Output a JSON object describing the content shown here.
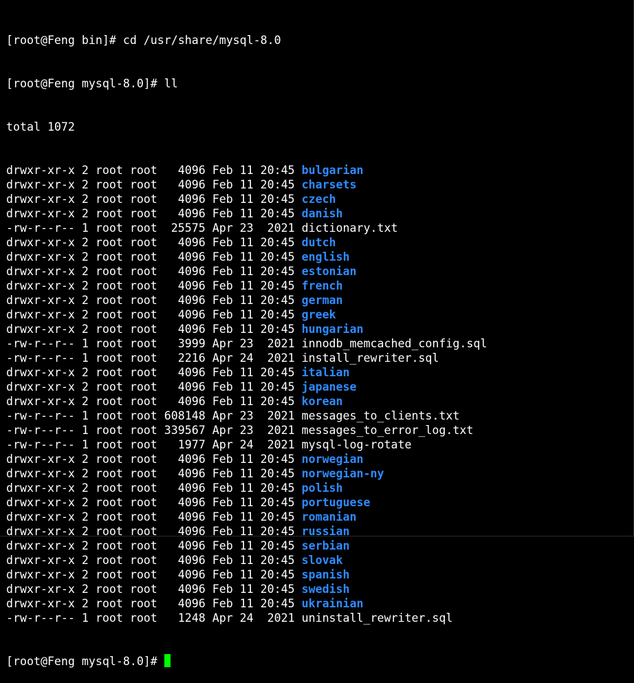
{
  "terminal": {
    "commands": [
      "[root@Feng bin]# cd /usr/share/mysql-8.0",
      "[root@Feng mysql-8.0]# ll"
    ],
    "total_line": "total 1072",
    "listing": [
      {
        "meta": "drwxr-xr-x 2 root root   4096 Feb 11 20:45 ",
        "name": "bulgarian",
        "type": "dir"
      },
      {
        "meta": "drwxr-xr-x 2 root root   4096 Feb 11 20:45 ",
        "name": "charsets",
        "type": "dir"
      },
      {
        "meta": "drwxr-xr-x 2 root root   4096 Feb 11 20:45 ",
        "name": "czech",
        "type": "dir"
      },
      {
        "meta": "drwxr-xr-x 2 root root   4096 Feb 11 20:45 ",
        "name": "danish",
        "type": "dir"
      },
      {
        "meta": "-rw-r--r-- 1 root root  25575 Apr 23  2021 ",
        "name": "dictionary.txt",
        "type": "file"
      },
      {
        "meta": "drwxr-xr-x 2 root root   4096 Feb 11 20:45 ",
        "name": "dutch",
        "type": "dir"
      },
      {
        "meta": "drwxr-xr-x 2 root root   4096 Feb 11 20:45 ",
        "name": "english",
        "type": "dir"
      },
      {
        "meta": "drwxr-xr-x 2 root root   4096 Feb 11 20:45 ",
        "name": "estonian",
        "type": "dir"
      },
      {
        "meta": "drwxr-xr-x 2 root root   4096 Feb 11 20:45 ",
        "name": "french",
        "type": "dir"
      },
      {
        "meta": "drwxr-xr-x 2 root root   4096 Feb 11 20:45 ",
        "name": "german",
        "type": "dir"
      },
      {
        "meta": "drwxr-xr-x 2 root root   4096 Feb 11 20:45 ",
        "name": "greek",
        "type": "dir"
      },
      {
        "meta": "drwxr-xr-x 2 root root   4096 Feb 11 20:45 ",
        "name": "hungarian",
        "type": "dir"
      },
      {
        "meta": "-rw-r--r-- 1 root root   3999 Apr 23  2021 ",
        "name": "innodb_memcached_config.sql",
        "type": "file"
      },
      {
        "meta": "-rw-r--r-- 1 root root   2216 Apr 24  2021 ",
        "name": "install_rewriter.sql",
        "type": "file"
      },
      {
        "meta": "drwxr-xr-x 2 root root   4096 Feb 11 20:45 ",
        "name": "italian",
        "type": "dir"
      },
      {
        "meta": "drwxr-xr-x 2 root root   4096 Feb 11 20:45 ",
        "name": "japanese",
        "type": "dir"
      },
      {
        "meta": "drwxr-xr-x 2 root root   4096 Feb 11 20:45 ",
        "name": "korean",
        "type": "dir"
      },
      {
        "meta": "-rw-r--r-- 1 root root 608148 Apr 23  2021 ",
        "name": "messages_to_clients.txt",
        "type": "file"
      },
      {
        "meta": "-rw-r--r-- 1 root root 339567 Apr 23  2021 ",
        "name": "messages_to_error_log.txt",
        "type": "file"
      },
      {
        "meta": "-rw-r--r-- 1 root root   1977 Apr 24  2021 ",
        "name": "mysql-log-rotate",
        "type": "file"
      },
      {
        "meta": "drwxr-xr-x 2 root root   4096 Feb 11 20:45 ",
        "name": "norwegian",
        "type": "dir"
      },
      {
        "meta": "drwxr-xr-x 2 root root   4096 Feb 11 20:45 ",
        "name": "norwegian-ny",
        "type": "dir"
      },
      {
        "meta": "drwxr-xr-x 2 root root   4096 Feb 11 20:45 ",
        "name": "polish",
        "type": "dir"
      },
      {
        "meta": "drwxr-xr-x 2 root root   4096 Feb 11 20:45 ",
        "name": "portuguese",
        "type": "dir"
      },
      {
        "meta": "drwxr-xr-x 2 root root   4096 Feb 11 20:45 ",
        "name": "romanian",
        "type": "dir"
      },
      {
        "meta": "drwxr-xr-x 2 root root   4096 Feb 11 20:45 ",
        "name": "russian",
        "type": "dir"
      },
      {
        "meta": "drwxr-xr-x 2 root root   4096 Feb 11 20:45 ",
        "name": "serbian",
        "type": "dir"
      },
      {
        "meta": "drwxr-xr-x 2 root root   4096 Feb 11 20:45 ",
        "name": "slovak",
        "type": "dir"
      },
      {
        "meta": "drwxr-xr-x 2 root root   4096 Feb 11 20:45 ",
        "name": "spanish",
        "type": "dir"
      },
      {
        "meta": "drwxr-xr-x 2 root root   4096 Feb 11 20:45 ",
        "name": "swedish",
        "type": "dir"
      },
      {
        "meta": "drwxr-xr-x 2 root root   4096 Feb 11 20:45 ",
        "name": "ukrainian",
        "type": "dir"
      },
      {
        "meta": "-rw-r--r-- 1 root root   1248 Apr 24  2021 ",
        "name": "uninstall_rewriter.sql",
        "type": "file"
      }
    ],
    "prompt": "[root@Feng mysql-8.0]# ",
    "colors": {
      "background": "#000000",
      "text": "#ffffff",
      "directory": "#2f8bff",
      "cursor": "#00ff00"
    }
  }
}
